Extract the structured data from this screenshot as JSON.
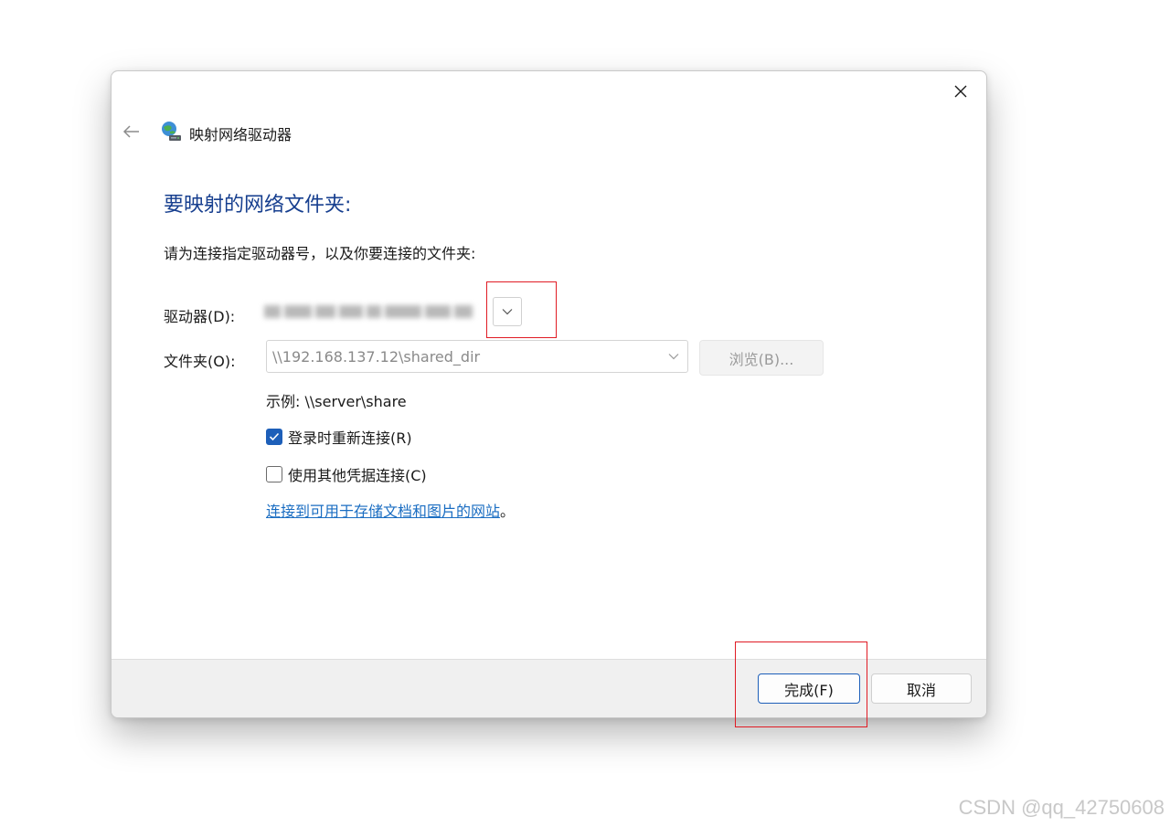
{
  "dialog": {
    "title": "映射网络驱动器",
    "heading": "要映射的网络文件夹:",
    "instruction": "请为连接指定驱动器号，以及你要连接的文件夹:",
    "drive": {
      "label": "驱动器(D):"
    },
    "folder": {
      "label": "文件夹(O):",
      "value": "\\\\192.168.137.12\\shared_dir",
      "browse_label": "浏览(B)..."
    },
    "example": "示例: \\\\server\\share",
    "reconnect": {
      "label": "登录时重新连接(R)",
      "checked": true
    },
    "other_credentials": {
      "label": "使用其他凭据连接(C)",
      "checked": false
    },
    "link": {
      "text": "连接到可用于存储文档和图片的网站",
      "suffix": "。"
    },
    "buttons": {
      "finish": "完成(F)",
      "cancel": "取消"
    }
  },
  "icons": {
    "close": "close-icon",
    "back": "back-arrow-icon",
    "title": "network-drive-icon",
    "chevron": "chevron-down-icon",
    "check": "checkmark-icon"
  },
  "colors": {
    "heading": "#173f8f",
    "link": "#1a6dc2",
    "accent": "#1d5fb9",
    "annotation": "#e01b24"
  },
  "watermark": "CSDN @qq_42750608"
}
